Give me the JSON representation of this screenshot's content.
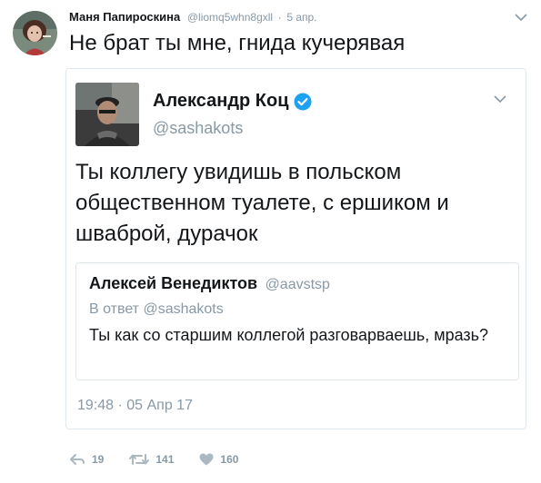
{
  "outer": {
    "author_name": "Маня Папироскина",
    "author_handle": "@liomq5whn8gxll",
    "separator": "·",
    "date": "5 апр.",
    "text": "Не брат ты мне, гнида кучерявая"
  },
  "embedded": {
    "author_name": "Александр Коц",
    "author_handle": "@sashakots",
    "text": "Ты коллегу увидишь в польском общественном туалете, с ершиком и шваброй, дурачок",
    "timestamp": "19:48 · 05 Апр 17",
    "quoted": {
      "author_name": "Алексей Венедиктов",
      "author_handle": "@aavstsp",
      "reply_to": "В ответ @sashakots",
      "text": "Ты как со старшим коллегой разговарваешь, мразь?"
    }
  },
  "actions": {
    "reply_count": "19",
    "retweet_count": "141",
    "like_count": "160"
  },
  "colors": {
    "text": "#14171a",
    "muted": "#8899a6",
    "border": "#e1e8ed",
    "verified": "#1da1f2"
  },
  "icons": {
    "reply": "reply-icon",
    "retweet": "retweet-icon",
    "like": "heart-icon",
    "more": "chevron-down-icon",
    "verified": "verified-badge-icon"
  }
}
